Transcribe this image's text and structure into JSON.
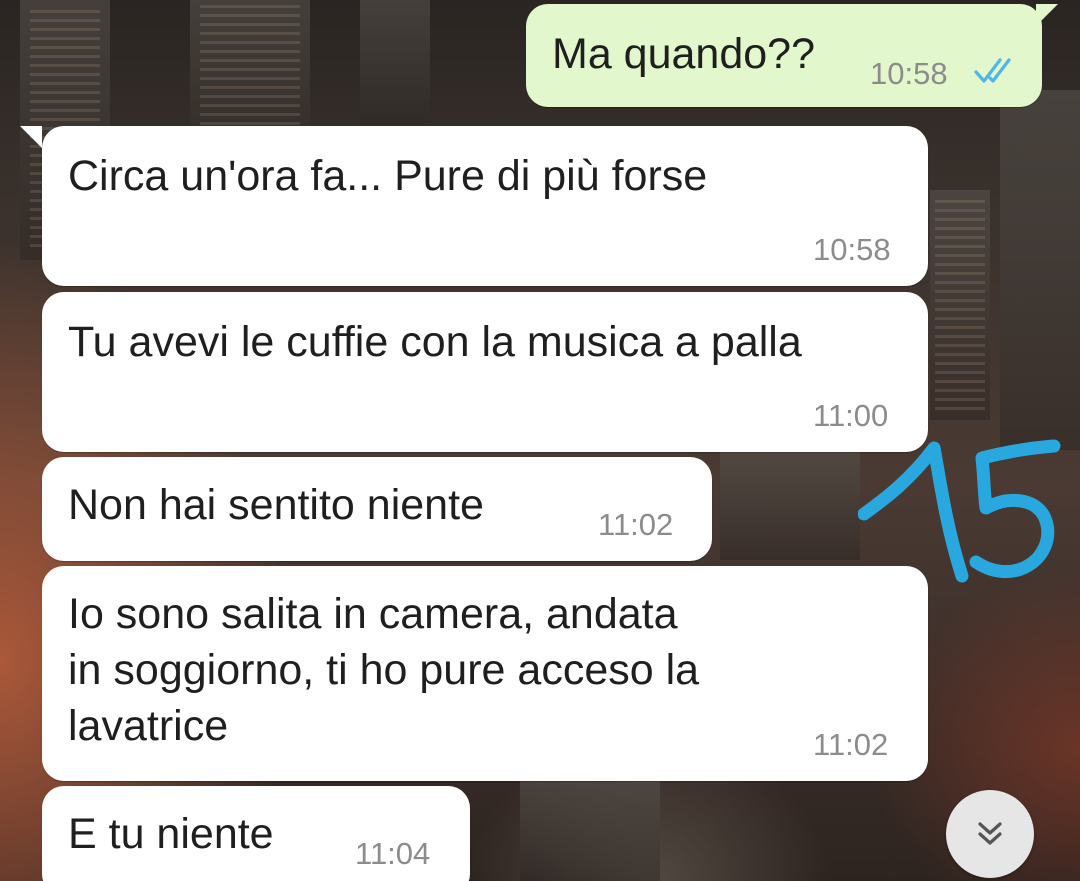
{
  "chat": {
    "messages": [
      {
        "direction": "outgoing",
        "text": "Ma quando??",
        "time": "10:58",
        "status_icon": "double-check-icon"
      },
      {
        "direction": "incoming",
        "text": "Circa un'ora fa... Pure di più forse",
        "time": "10:58"
      },
      {
        "direction": "incoming",
        "text": "Tu avevi le cuffie con la musica a palla",
        "time": "11:00"
      },
      {
        "direction": "incoming",
        "text": "Non hai sentito niente",
        "time": "11:02"
      },
      {
        "direction": "incoming",
        "text": "Io sono salita in camera, andata\nin soggiorno, ti ho pure acceso la\nlavatrice",
        "time": "11:02"
      },
      {
        "direction": "incoming",
        "text": "E tu niente",
        "time": "11:04"
      }
    ],
    "scroll_down_icon": "double-chevron-down-icon"
  },
  "annotation": {
    "text": "15",
    "color": "#29a8e0"
  },
  "colors": {
    "incoming_bubble": "#ffffff",
    "outgoing_bubble": "#e2f7cb",
    "tick_blue": "#4fb6ec",
    "time_gray": "#8c8c8c"
  }
}
